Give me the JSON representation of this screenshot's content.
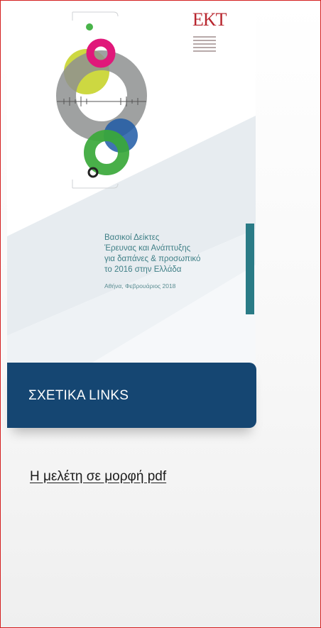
{
  "cover": {
    "logo_text": "EKT",
    "title_lines": [
      "Βασικοί Δείκτες",
      "Έρευνας και Ανάπτυξης",
      "για δαπάνες & προσωπικό",
      "το 2016 στην Ελλάδα"
    ],
    "date": "Αθήνα, Φεβρουάριος 2018"
  },
  "related": {
    "header": "ΣΧΕΤΙΚΑ LINKS",
    "links": [
      {
        "label": "Η μελέτη σε μορφή pdf"
      }
    ]
  },
  "colors": {
    "header_bg": "#154672",
    "frame_border": "#d42020",
    "cover_accent": "#2a7b86",
    "circle_magenta": "#e0187a",
    "circle_yellow": "#c8d42c",
    "circle_gray": "#8e9090",
    "circle_blue": "#1f5aa6",
    "circle_green": "#3aa83a"
  }
}
